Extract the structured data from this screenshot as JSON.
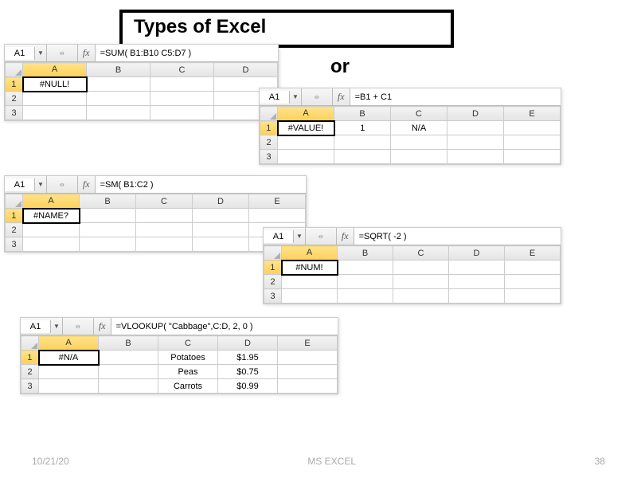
{
  "title": "Types of Excel",
  "subtitle_fragment": "or",
  "fx_label": "fx",
  "footer": {
    "date": "10/21/20",
    "label": "MS EXCEL",
    "page": "38"
  },
  "snippets": {
    "null_err": {
      "cell_ref": "A1",
      "formula": "=SUM( B1:B10 C5:D7 )",
      "cols": [
        "A",
        "B",
        "C",
        "D"
      ],
      "rows": [
        "1",
        "2",
        "3"
      ],
      "a1": "#NULL!"
    },
    "value_err": {
      "cell_ref": "A1",
      "formula": "=B1 + C1",
      "cols": [
        "A",
        "B",
        "C",
        "D",
        "E"
      ],
      "rows": [
        "1",
        "2",
        "3"
      ],
      "a1": "#VALUE!",
      "b1": "1",
      "c1": "N/A"
    },
    "name_err": {
      "cell_ref": "A1",
      "formula": "=SM( B1:C2 )",
      "cols": [
        "A",
        "B",
        "C",
        "D",
        "E"
      ],
      "rows": [
        "1",
        "2",
        "3"
      ],
      "a1": "#NAME?"
    },
    "num_err": {
      "cell_ref": "A1",
      "formula": "=SQRT( -2 )",
      "cols": [
        "A",
        "B",
        "C",
        "D",
        "E"
      ],
      "rows": [
        "1",
        "2",
        "3"
      ],
      "a1": "#NUM!"
    },
    "na_err": {
      "cell_ref": "A1",
      "formula": "=VLOOKUP( \"Cabbage\",C:D, 2, 0 )",
      "cols": [
        "A",
        "B",
        "C",
        "D",
        "E"
      ],
      "rows": [
        "1",
        "2",
        "3"
      ],
      "a1": "#N/A",
      "data": {
        "c1": "Potatoes",
        "d1": "$1.95",
        "c2": "Peas",
        "d2": "$0.75",
        "c3": "Carrots",
        "d3": "$0.99"
      }
    }
  }
}
